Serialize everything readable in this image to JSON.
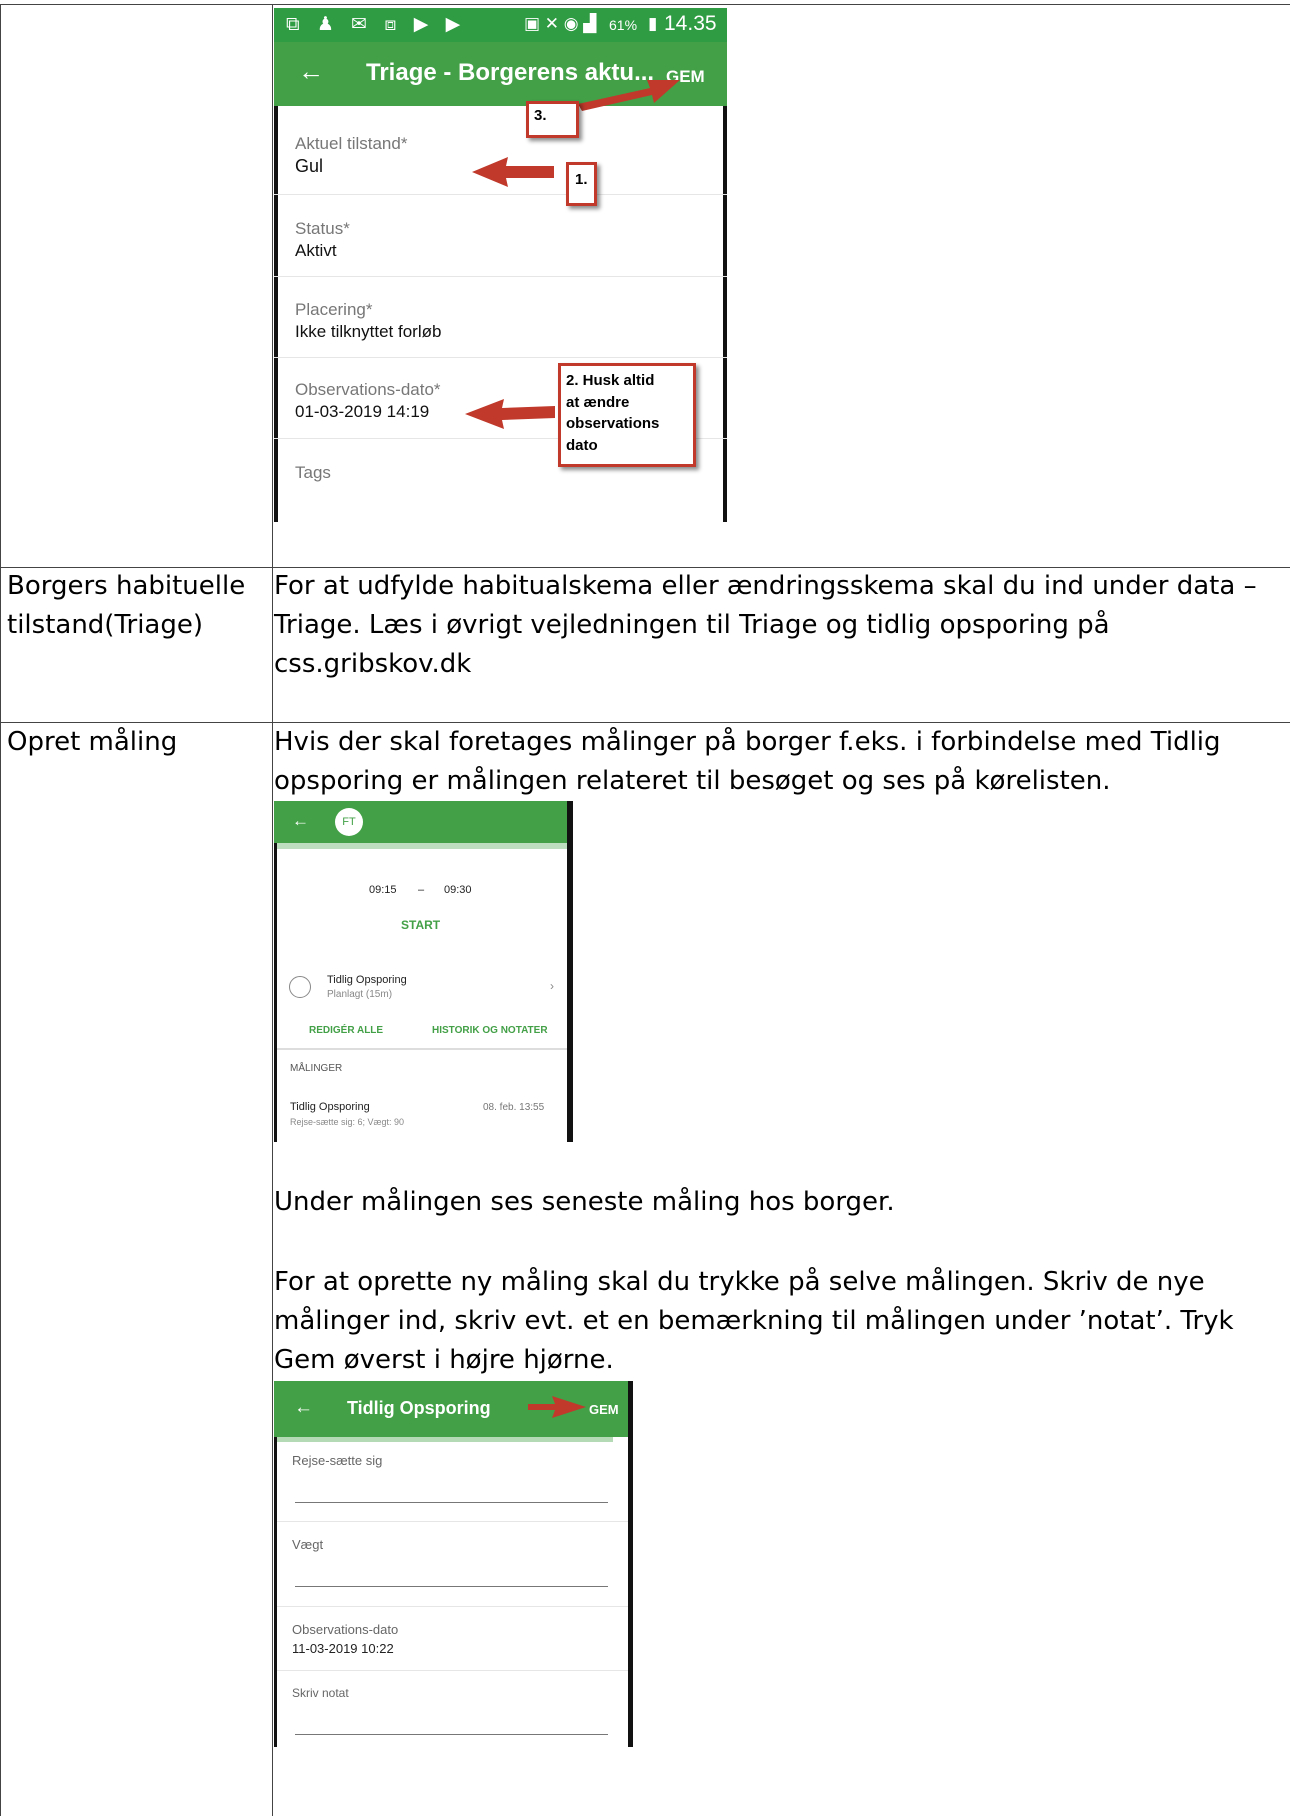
{
  "colors": {
    "accent_green": "#43a047",
    "status_green": "#2f9b43",
    "arrow_red": "#c0392b"
  },
  "row1": {
    "phone": {
      "status_time": "14.35",
      "status_battery": "61%",
      "title": "Triage - Borgerens aktu...",
      "save_label": "GEM",
      "fields": [
        {
          "label": "Aktuel tilstand*",
          "value": "Gul"
        },
        {
          "label": "Status*",
          "value": "Aktivt"
        },
        {
          "label": "Placering*",
          "value": "Ikke tilknyttet forløb"
        },
        {
          "label": "Observations-dato*",
          "value": "01-03-2019 14:19"
        },
        {
          "label": "Tags",
          "value": ""
        }
      ]
    },
    "callouts": {
      "c1": "1.",
      "c2_lines": [
        "2. Husk altid",
        "at ændre",
        "observations",
        "dato"
      ],
      "c3": "3."
    }
  },
  "row2": {
    "label_lines": [
      "Borgers habituelle",
      "tilstand(Triage)"
    ],
    "text_lines": [
      "For at udfylde habitualskema eller ændringsskema skal du ind under data –",
      "Triage.  Læs i øvrigt vejledningen til Triage og tidlig opsporing på",
      "css.gribskov.dk"
    ]
  },
  "row3": {
    "label": "Opret måling",
    "intro_lines": [
      "Hvis der skal foretages målinger på borger f.eks. i forbindelse med Tidlig",
      "opsporing er målingen relateret til besøget og ses på kørelisten."
    ],
    "phone2": {
      "avatar": "FT",
      "time_start": "09:15",
      "time_sep": "–",
      "time_end": "09:30",
      "start_label": "START",
      "task_title": "Tidlig Opsporing",
      "task_sub": "Planlagt (15m)",
      "edit_all": "REDIGÉR ALLE",
      "history": "HISTORIK OG NOTATER",
      "section": "MÅLINGER",
      "measure_title": "Tidlig Opsporing",
      "measure_date": "08. feb. 13:55",
      "measure_values": "Rejse-sætte sig: 6; Vægt: 90"
    },
    "para1": "Under målingen ses seneste måling hos borger.",
    "para2_lines": [
      "For at oprette ny måling skal du trykke på selve målingen. Skriv de nye",
      "målinger ind, skriv evt. et en bemærkning til målingen under ’notat’. Tryk",
      "Gem øverst i højre hjørne."
    ],
    "phone3": {
      "title": "Tidlig Opsporing",
      "save_label": "GEM",
      "fields": [
        {
          "label": "Rejse-sætte sig",
          "value": ""
        },
        {
          "label": "Vægt",
          "value": ""
        },
        {
          "label": "Observations-dato",
          "value": "11-03-2019 10:22"
        },
        {
          "label": "Skriv notat",
          "value": ""
        }
      ]
    }
  }
}
